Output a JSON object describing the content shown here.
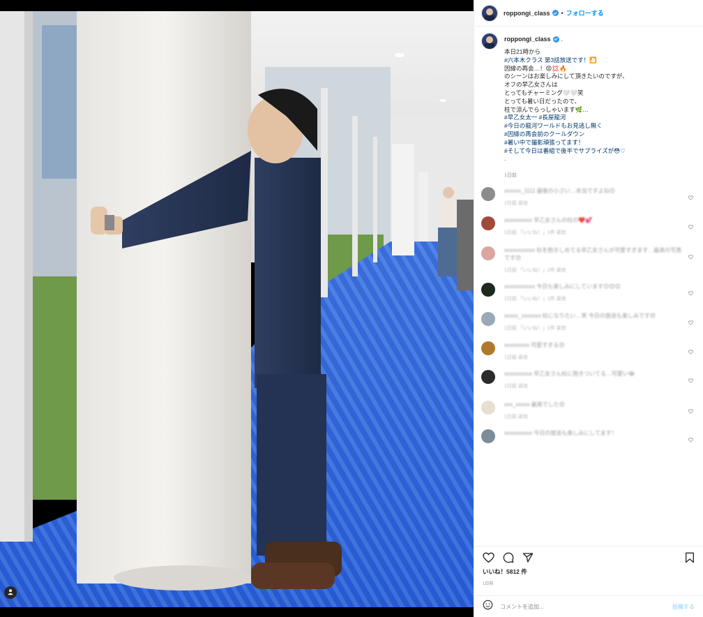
{
  "post": {
    "username": "roppongi_class",
    "follow_label": "フォローする",
    "dot": "•",
    "caption_username": "roppongi_class",
    "caption_suffix": ".",
    "caption_lines": [
      {
        "text": "本日21時から",
        "tag": false
      },
      {
        "text": "#六本木クラス 第3話放送です！🎦",
        "tag": true
      },
      {
        "text": " ",
        "tag": false
      },
      {
        "text": "因縁の再会…！😡💢🔥",
        "tag": false
      },
      {
        "text": "のシーンはお楽しみにして頂きたいのですが、",
        "tag": false
      },
      {
        "text": "オフの早乙女さんは",
        "tag": false
      },
      {
        "text": "とってもチャーミング🤍🤍笑",
        "tag": false
      },
      {
        "text": " ",
        "tag": false
      },
      {
        "text": "とっても暑い日だったので、",
        "tag": false
      },
      {
        "text": "柱で涼んでらっしゃいます🌿…",
        "tag": false
      },
      {
        "text": " ",
        "tag": false
      },
      {
        "text": "#早乙女太一 #長屋龍河",
        "tag": true
      },
      {
        "text": "#今日の龍河ワールドもお見逃し無く",
        "tag": true
      },
      {
        "text": "#因縁の再会前のクールダウン",
        "tag": true
      },
      {
        "text": "#暑い中で撮影頑張ってます！",
        "tag": true
      },
      {
        "text": "#そして今日は番組で後半でサプライズが😳♡",
        "tag": true
      },
      {
        "text": " ",
        "tag": false
      },
      {
        "text": ".",
        "tag": false
      }
    ],
    "caption_time": "1日前",
    "likes_label": "いいね！5812 件",
    "post_time": "1日前",
    "comment_placeholder": "コメントを追加...",
    "post_button": "投稿する"
  },
  "comments": [
    {
      "text": "xxxxxx_1111 最後の小さい…本当ですよね😊",
      "meta": "1日前  返信",
      "avatar_color": "#8c8c8c"
    },
    {
      "text": "xxxxxxxxxx 早乙女さんの柱の❤️💕",
      "meta": "1日前  「いいね！」1件  返信",
      "avatar_color": "#a24a3a"
    },
    {
      "text": "xxxxxxxxxxx 柱を抱きしめてる早乙女さんが可愛すぎます…最高の写真です😍",
      "meta": "1日前  「いいね！」2件  返信",
      "avatar_color": "#d9a7a0"
    },
    {
      "text": "xxxxxxxxxxx 今日も楽しみにしています😊😊😊",
      "meta": "1日前  「いいね！」1件  返信",
      "avatar_color": "#1f2a1f"
    },
    {
      "text": "xxxxx_xxxxxxx 柱になりたい…笑 今日の放送も楽しみです😍",
      "meta": "1日前  「いいね！」1件  返信",
      "avatar_color": "#9aa9b8"
    },
    {
      "text": "xxxxxxxxx 可愛すぎる😍",
      "meta": "1日前  返信",
      "avatar_color": "#b07a2e"
    },
    {
      "text": "xxxxxxxxxx 早乙女さん柱に抱きついてる…可愛い😂",
      "meta": "1日前  返信",
      "avatar_color": "#2b2b2b"
    },
    {
      "text": "xxx_xxxxx 最高でした😍",
      "meta": "1日前  返信",
      "avatar_color": "#e8dfd2"
    },
    {
      "text": "xxxxxxxxxx 今日の放送も楽しみにしてます！",
      "meta": "",
      "avatar_color": "#7d8c99"
    }
  ],
  "colors": {
    "accent": "#0095f6",
    "verified": "#3897f0",
    "link": "#00376b"
  },
  "icons": [
    "verified-icon",
    "heart-icon",
    "comment-icon",
    "share-icon",
    "save-icon",
    "emoji-icon",
    "user-tag-icon"
  ]
}
